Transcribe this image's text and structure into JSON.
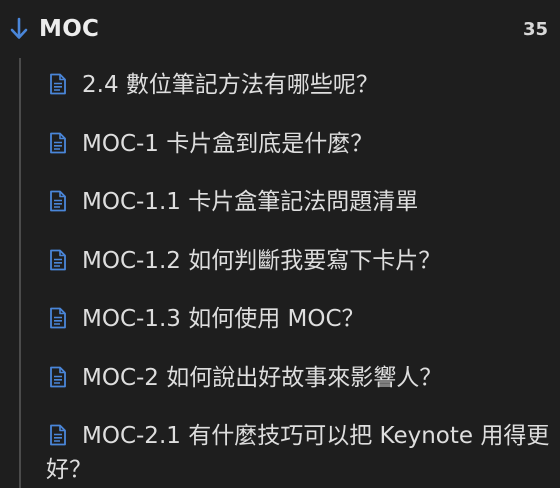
{
  "group": {
    "title": "MOC",
    "count": "35"
  },
  "colors": {
    "background": "#1e1e1e",
    "accent": "#4a86d9",
    "text": "#dedede",
    "tree_line": "#4b4b4b"
  },
  "icons": {
    "collapse": "arrow-down-icon",
    "item": "file-text-icon"
  },
  "items": [
    {
      "label": "2.4 數位筆記方法有哪些呢？"
    },
    {
      "label": "MOC-1 卡片盒到底是什麼？"
    },
    {
      "label": "MOC-1.1 卡片盒筆記法問題清單"
    },
    {
      "label": "MOC-1.2 如何判斷我要寫下卡片？"
    },
    {
      "label": "MOC-1.3 如何使用 MOC？"
    },
    {
      "label": "MOC-2 如何說出好故事來影響人？"
    },
    {
      "label": "MOC-2.1 有什麼技巧可以把 Keynote 用得更好？"
    }
  ]
}
